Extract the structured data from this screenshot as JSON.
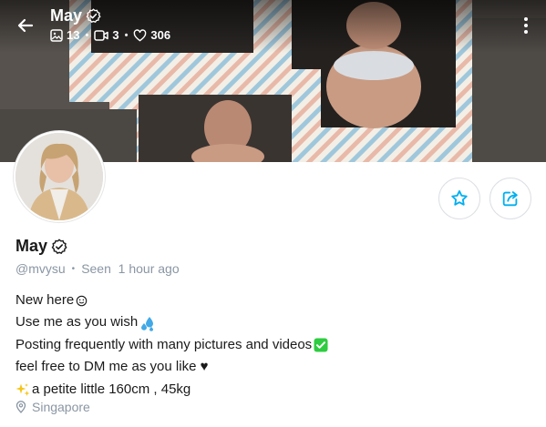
{
  "header": {
    "title": "May",
    "stats": {
      "photos": "13",
      "videos": "3",
      "likes": "306"
    }
  },
  "profile": {
    "name": "May",
    "handle": "@mvysu",
    "seen": "Seen  1 hour ago",
    "bio": [
      {
        "text": "New here",
        "emoji": "smiling-face-icon"
      },
      {
        "text": "Use me as you wish",
        "emoji": "sweat-droplets-icon"
      },
      {
        "text": "Posting frequently with many pictures and videos",
        "emoji": "check-mark-button-icon"
      },
      {
        "text": "feel free to DM me as you like ♥",
        "emoji": ""
      },
      {
        "text": "a petite little 160cm , 45kg",
        "emoji": "sparkles-icon"
      }
    ],
    "location": "Singapore"
  },
  "colors": {
    "accent": "#00aff0",
    "muted": "#8a96a3",
    "text": "#1a1a1a",
    "check_green": "#2ecc40"
  },
  "icons": {
    "back": "arrow-left-icon",
    "verified": "verified-badge-icon",
    "photos": "image-icon",
    "videos": "video-icon",
    "likes": "heart-icon",
    "more": "more-vertical-icon",
    "favorite": "star-icon",
    "share": "share-icon",
    "location": "location-pin-icon"
  }
}
